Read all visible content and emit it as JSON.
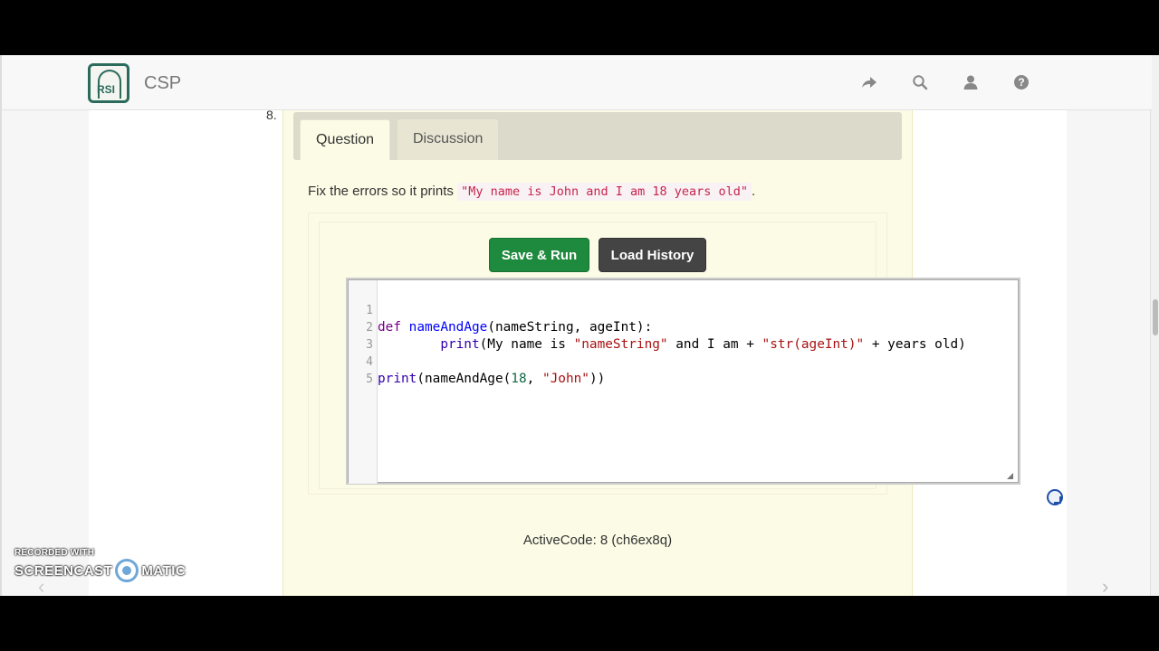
{
  "navbar": {
    "brand": "CSP",
    "logo_text": "RSI",
    "icons": [
      "share-icon",
      "search-icon",
      "user-icon",
      "help-icon"
    ]
  },
  "question": {
    "number": "8.",
    "tabs": [
      {
        "label": "Question",
        "active": true
      },
      {
        "label": "Discussion",
        "active": false
      }
    ],
    "prompt_text": "Fix the errors so it prints",
    "prompt_code": "\"My name is John and I am 18 years old\"",
    "prompt_end": "."
  },
  "buttons": {
    "save_run": "Save & Run",
    "load_history": "Load History"
  },
  "editor": {
    "line_numbers": [
      "1",
      "2",
      "3",
      "4",
      "5"
    ],
    "lines": [
      "def nameAndAge(nameString, ageInt):",
      "        print(My name is \"nameString\" and I am + \"str(ageInt)\" + years old)",
      "",
      "print(nameAndAge(18, \"John\"))",
      ""
    ]
  },
  "caption": "ActiveCode: 8 (ch6ex8q)",
  "watermark": {
    "line1": "RECORDED WITH",
    "line2_a": "SCREENCAST",
    "line2_b": "MATIC"
  },
  "colors": {
    "save_button": "#1e8a3d",
    "load_button": "#444444",
    "activecode_bg": "#fcfbe6",
    "tabbar_bg": "#dcdbcb",
    "brand_color": "#2a6b5c"
  }
}
